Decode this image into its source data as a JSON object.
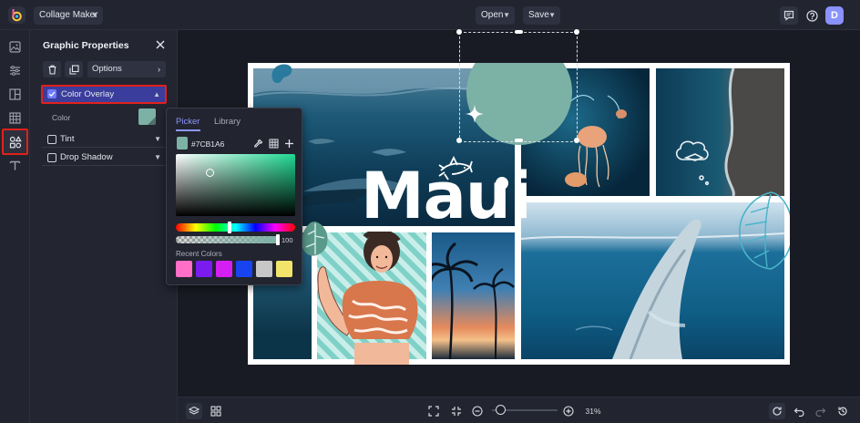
{
  "app": {
    "doc_title": "Collage Maker",
    "open_label": "Open",
    "save_label": "Save",
    "user_initial": "D"
  },
  "panel": {
    "title": "Graphic Properties",
    "options_label": "Options",
    "sections": [
      {
        "label": "Color Overlay",
        "checked": true
      },
      {
        "label": "Tint",
        "checked": false
      },
      {
        "label": "Drop Shadow",
        "checked": false
      }
    ],
    "color_label": "Color"
  },
  "picker": {
    "tab_picker": "Picker",
    "tab_library": "Library",
    "hex": "#7CB1A6",
    "alpha": "100",
    "recent_label": "Recent Colors",
    "recent_colors": [
      "#ff6ec7",
      "#7a1cf0",
      "#d41ff2",
      "#1744f0",
      "#c7c7c7",
      "#f2e36b"
    ]
  },
  "canvas": {
    "headline": "Maui"
  },
  "zoom": {
    "value": "31%",
    "level": 0.12
  },
  "colors": {
    "accent": "#8e97ff",
    "overlay": "#7cb1a6",
    "highlight": "#e0211c"
  }
}
